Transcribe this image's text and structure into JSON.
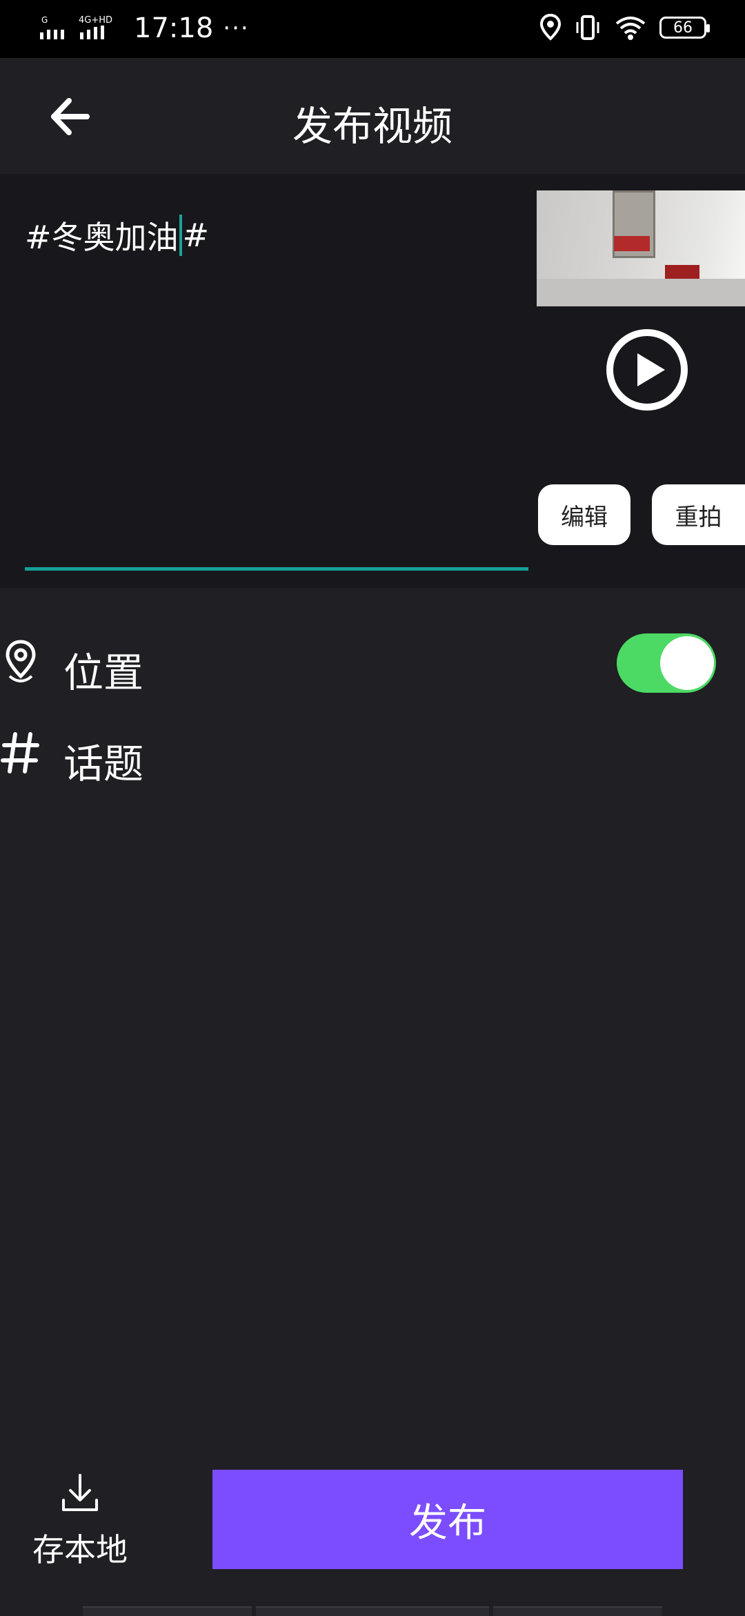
{
  "status_bar": {
    "signal_1": "G",
    "signal_2": "4G+HD",
    "time": "17:18",
    "more": "···",
    "battery": "66"
  },
  "header": {
    "title": "发布视频",
    "back_icon": "arrow-left-icon"
  },
  "compose": {
    "caption_before_cursor": "#冬奥加油",
    "caption_after_cursor": "#",
    "edit_label": "编辑",
    "reshoot_label": "重拍",
    "play_icon": "play-circle-icon",
    "accent_color": "#13a097"
  },
  "options": {
    "location": {
      "label": "位置",
      "icon": "location-pin-icon",
      "enabled": true,
      "toggle_color": "#4cd964"
    },
    "topic": {
      "label": "话题",
      "icon": "hashtag-icon"
    }
  },
  "footer": {
    "save_label": "存本地",
    "save_icon": "download-icon",
    "publish_label": "发布",
    "publish_color": "#7b4dff"
  }
}
